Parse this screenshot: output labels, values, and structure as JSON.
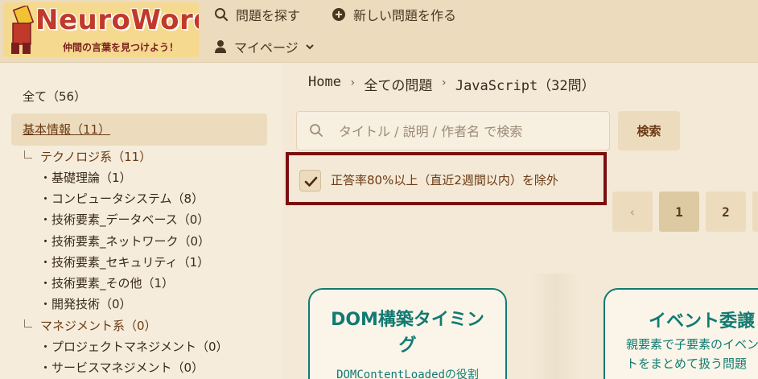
{
  "header": {
    "logo_title": "NeuroWord",
    "logo_subtitle": "仲間の言葉を見つけよう！",
    "nav_search": "問題を探す",
    "nav_new": "新しい問題を作る",
    "nav_mypage": "マイページ"
  },
  "sidebar": {
    "all": "全て（56）",
    "basic": "基本情報（11）",
    "tech": "テクノロジ系（11）",
    "tech_items": [
      "・基礎理論（1）",
      "・コンピュータシステム（8）",
      "・技術要素_データベース（0）",
      "・技術要素_ネットワーク（0）",
      "・技術要素_セキュリティ（1）",
      "・技術要素_その他（1）",
      "・開発技術（0）"
    ],
    "mgmt": "マネジメント系（0）",
    "mgmt_items": [
      "・プロジェクトマネジメント（0）",
      "・サービスマネジメント（0）"
    ]
  },
  "breadcrumb": {
    "home": "Home",
    "all": "全ての問題",
    "current": "JavaScript（32問）",
    "sep": "›"
  },
  "search": {
    "placeholder": "タイトル / 説明 / 作者名 で検索",
    "button": "検索"
  },
  "filter": {
    "label": "正答率80%以上（直近2週間以内）を除外",
    "checked": true
  },
  "pagination": {
    "prev": "‹",
    "pages": [
      "1",
      "2"
    ],
    "current": "1"
  },
  "cards": [
    {
      "title": "DOM構築タイミング",
      "title_line1": "DOM構築タイミン",
      "title_line2": "グ",
      "desc": "DOMContentLoadedの役割"
    },
    {
      "title": "イベント委譲",
      "desc_line1": "親要素で子要素のイベン",
      "desc_line2": "トをまとめて扱う問題"
    }
  ],
  "colors": {
    "accent": "#127a72",
    "brand": "#c0392b",
    "highlight_border": "#7a0f0f",
    "background": "#f3e9d6"
  }
}
